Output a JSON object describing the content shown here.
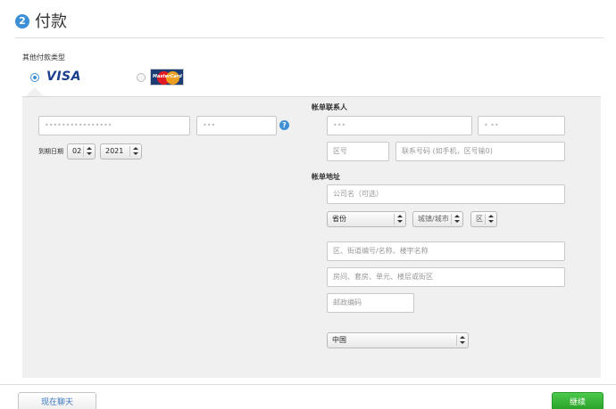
{
  "header": {
    "step_number": "2",
    "title": "付款"
  },
  "payment": {
    "section_label": "其他付款类型",
    "visa_label": "VISA",
    "mastercard_label": "MasterCard",
    "selected": "visa"
  },
  "card": {
    "number_value": "••••••••••••••••",
    "cvv_value": "•••",
    "expiry_label": "到期日期",
    "expiry_month": "02",
    "expiry_year": "2021",
    "help_glyph": "?"
  },
  "billing_contact": {
    "heading": "帐单联系人",
    "first_name_value": "•••",
    "last_name_value": "• ••",
    "area_code_placeholder": "区号",
    "phone_placeholder": "联系号码 (如手机，区号输0)"
  },
  "billing_address": {
    "heading": "帐单地址",
    "company_placeholder": "公司名（可选）",
    "province_value": "省份",
    "city_value": "城镇/城市",
    "district_value": "区",
    "street_placeholder": "区、街道编号/名称、楼宇名称",
    "room_placeholder": "房间、套房、单元、楼层或街区",
    "postcode_placeholder": "邮政编码",
    "country_value": "中国"
  },
  "footer": {
    "chat_label": "现在聊天",
    "continue_label": "继续"
  },
  "colors": {
    "accent": "#3f8fd6",
    "continue": "#2fa82f",
    "panel": "#f0f0f0"
  }
}
